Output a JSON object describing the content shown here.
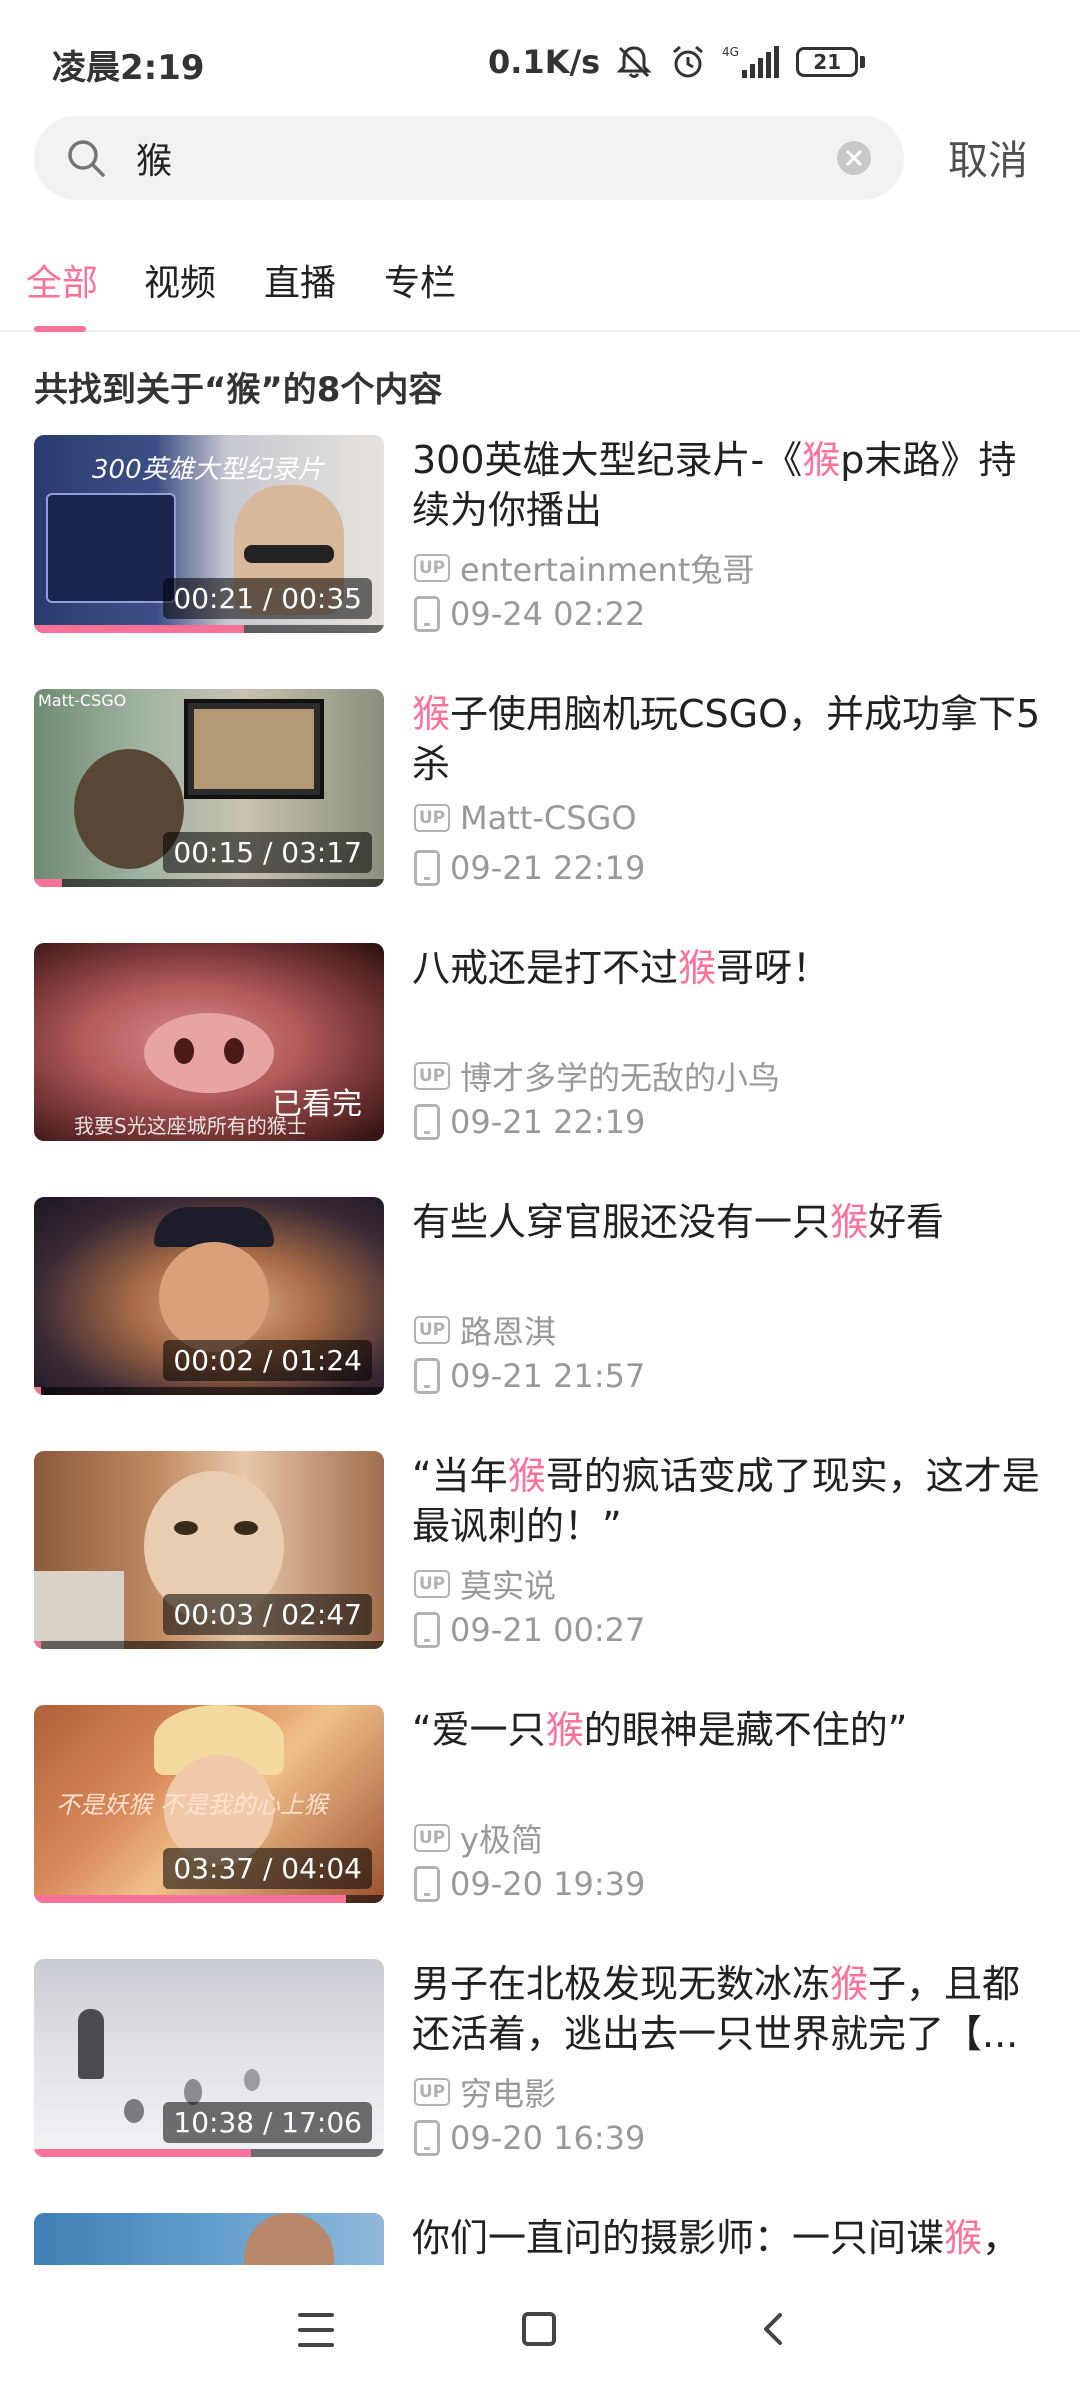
{
  "status_bar": {
    "time": "凌晨2:19",
    "speed": "0.1K/s",
    "network": "4G",
    "battery": "21"
  },
  "search": {
    "query": "猴",
    "cancel_label": "取消"
  },
  "tabs": [
    {
      "label": "全部"
    },
    {
      "label": "视频"
    },
    {
      "label": "直播"
    },
    {
      "label": "专栏"
    }
  ],
  "result_count": "共找到关于“猴”的8个内容",
  "results": [
    {
      "title_before": "300英雄大型纪录片-《",
      "title_highlight": "猴",
      "title_after": "p末路》持续为你播出",
      "uploader": "entertainment兔哥",
      "date": "09-24 02:22",
      "duration": "00:21 / 00:35",
      "progress": 0.6,
      "thumb_text": "300英雄大型纪录片"
    },
    {
      "title_before": "",
      "title_highlight": "猴",
      "title_after": "子使用脑机玩CSGO，并成功拿下5杀",
      "uploader": "Matt-CSGO",
      "date": "09-21 22:19",
      "duration": "00:15 / 03:17",
      "progress": 0.08,
      "thumb_text": "Matt-CSGO"
    },
    {
      "title_before": "八戒还是打不过",
      "title_highlight": "猴",
      "title_after": "哥呀！",
      "uploader": "博才多学的无敌的小鸟",
      "date": "09-21 22:19",
      "duration": "已看完",
      "progress": 1.0,
      "thumb_text": "我要S光这座城所有的猴士"
    },
    {
      "title_before": "有些人穿官服还没有一只",
      "title_highlight": "猴",
      "title_after": "好看",
      "uploader": "路恩淇",
      "date": "09-21 21:57",
      "duration": "00:02 / 01:24",
      "progress": 0.02,
      "thumb_text": ""
    },
    {
      "title_before": "“当年",
      "title_highlight": "猴",
      "title_after": "哥的疯话变成了现实，这才是最讽刺的！”",
      "uploader": "莫实说",
      "date": "09-21 00:27",
      "duration": "00:03 / 02:47",
      "progress": 0.02,
      "thumb_text": ""
    },
    {
      "title_before": "“爱一只",
      "title_highlight": "猴",
      "title_after": "的眼神是藏不住的”",
      "uploader": "y极简",
      "date": "09-20 19:39",
      "duration": "03:37 / 04:04",
      "progress": 0.89,
      "thumb_text": "不是妖猴 不是我的心上猴"
    },
    {
      "title_before": "男子在北极发现无数冰冻",
      "title_highlight": "猴",
      "title_after": "子，且都还活着，逃出去一只世界就完了【...",
      "uploader": "穷电影",
      "date": "09-20 16:39",
      "duration": "10:38 / 17:06",
      "progress": 0.62,
      "thumb_text": ""
    },
    {
      "title_before": "你们一直问的摄影师：一只间谍",
      "title_highlight": "猴",
      "title_after": "，",
      "uploader": "",
      "date": "",
      "duration": "",
      "progress": 0,
      "thumb_text": ""
    }
  ],
  "colors": {
    "accent": "#fb7299",
    "text_primary": "#212121",
    "text_secondary": "#999999"
  }
}
